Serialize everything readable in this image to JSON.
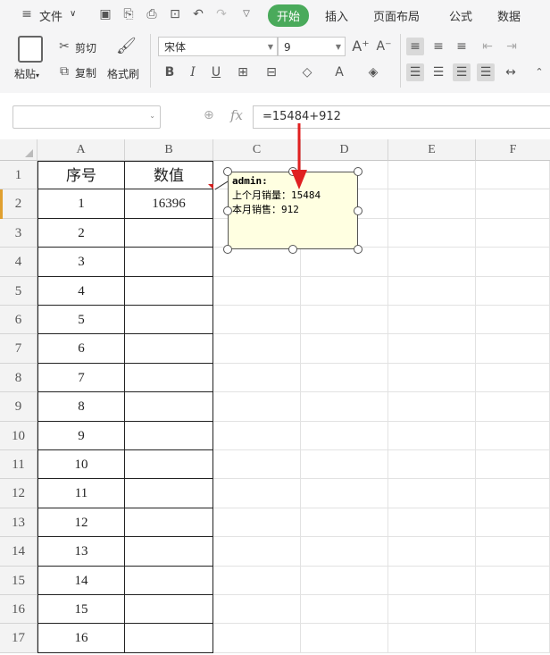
{
  "menu": {
    "file": "文件",
    "tabs": [
      "开始",
      "插入",
      "页面布局",
      "公式",
      "数据"
    ],
    "active_tab": "开始"
  },
  "ribbon": {
    "paste": "粘贴",
    "cut": "剪切",
    "copy": "复制",
    "format_painter": "格式刷",
    "font_name": "宋体",
    "font_size": "9"
  },
  "formula_bar": {
    "name_box": "",
    "fx": "fx",
    "formula": "=15484+912"
  },
  "columns": [
    "A",
    "B",
    "C",
    "D",
    "E",
    "F"
  ],
  "rows": [
    "1",
    "2",
    "3",
    "4",
    "5",
    "6",
    "7",
    "8",
    "9",
    "10",
    "11",
    "12",
    "13",
    "14",
    "15",
    "16",
    "17"
  ],
  "table": {
    "header": [
      "序号",
      "数值"
    ],
    "rows": [
      [
        "1",
        "16396"
      ],
      [
        "2",
        ""
      ],
      [
        "3",
        ""
      ],
      [
        "4",
        ""
      ],
      [
        "5",
        ""
      ],
      [
        "6",
        ""
      ],
      [
        "7",
        ""
      ],
      [
        "8",
        ""
      ],
      [
        "9",
        ""
      ],
      [
        "10",
        ""
      ],
      [
        "11",
        ""
      ],
      [
        "12",
        ""
      ],
      [
        "13",
        ""
      ],
      [
        "14",
        ""
      ],
      [
        "15",
        ""
      ],
      [
        "16",
        ""
      ]
    ]
  },
  "comment": {
    "author": "admin:",
    "line1": "上个月销量：15484",
    "line2": "本月销售：912"
  },
  "colors": {
    "accent_green": "#4aaa5b",
    "comment_bg": "#ffffe1",
    "arrow_red": "#e02020"
  }
}
